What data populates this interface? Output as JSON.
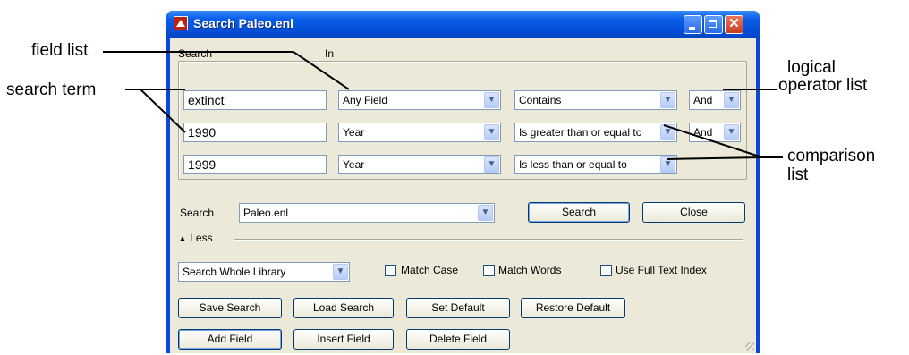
{
  "callouts": {
    "field_list": "field list",
    "search_term": "search term",
    "logical_line1": "logical",
    "logical_line2": "operator list",
    "comparison_line1": "comparison",
    "comparison_line2": "list"
  },
  "window": {
    "title": "Search Paleo.enl",
    "close_glyph": "✕"
  },
  "criteria": {
    "search_header": "Search",
    "in_header": "In",
    "rows": [
      {
        "term": "extinct",
        "field": "Any Field",
        "comparison": "Contains",
        "operator": "And"
      },
      {
        "term": "1990",
        "field": "Year",
        "comparison": "Is greater than or equal tc",
        "operator": "And"
      },
      {
        "term": "1999",
        "field": "Year",
        "comparison": "Is less than or equal to",
        "operator": ""
      }
    ]
  },
  "library": {
    "label": "Search",
    "value": "Paleo.enl",
    "search_button": "Search",
    "close_button": "Close"
  },
  "less_toggle": "Less",
  "options": {
    "scope": "Search Whole Library",
    "match_case": "Match Case",
    "match_words": "Match Words",
    "full_text": "Use Full Text Index"
  },
  "buttons": {
    "save_search": "Save Search",
    "load_search": "Load Search",
    "set_default": "Set Default",
    "restore_default": "Restore Default",
    "add_field": "Add Field",
    "insert_field": "Insert Field",
    "delete_field": "Delete Field"
  },
  "icons": {
    "dropdown": "▼",
    "less": "▲"
  }
}
